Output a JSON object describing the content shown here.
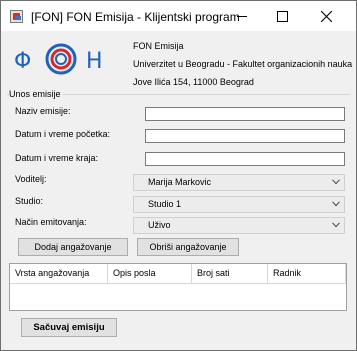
{
  "window": {
    "title": "[FON] FON Emisija - Klijentski program"
  },
  "header": {
    "institution": "FON Emisija",
    "university": "Univerzitet u Beogradu - Fakultet organizacionih nauka",
    "address": "Jove Ilića 154, 11000 Beograd"
  },
  "form": {
    "group_title": "Unos emisije",
    "naziv_label": "Naziv emisije:",
    "naziv_value": "",
    "pocetak_label": "Datum i vreme početka:",
    "pocetak_value": "",
    "kraj_label": "Datum i vreme kraja:",
    "kraj_value": "",
    "voditelj_label": "Voditelj:",
    "voditelj_value": "Marija Markovic",
    "studio_label": "Studio:",
    "studio_value": "Studio 1",
    "emitovanje_label": "Način emitovanja:",
    "emitovanje_value": "Uživo"
  },
  "buttons": {
    "dodaj": "Dodaj angažovanje",
    "obrisi": "Obriši angažovanje",
    "sacuvaj": "Sačuvaj emisiju"
  },
  "table": {
    "columns": [
      "Vrsta angažovanja",
      "Opis posla",
      "Broj sati",
      "Radnik"
    ]
  },
  "icons": {
    "app": "app-window-icon",
    "minimize": "minimize-icon",
    "maximize": "maximize-icon",
    "close": "close-icon",
    "dropdown": "chevron-down-icon"
  },
  "colors": {
    "logo_blue": "#1f62b8",
    "logo_red": "#d8272f",
    "window_bg": "#f0f0f0"
  }
}
